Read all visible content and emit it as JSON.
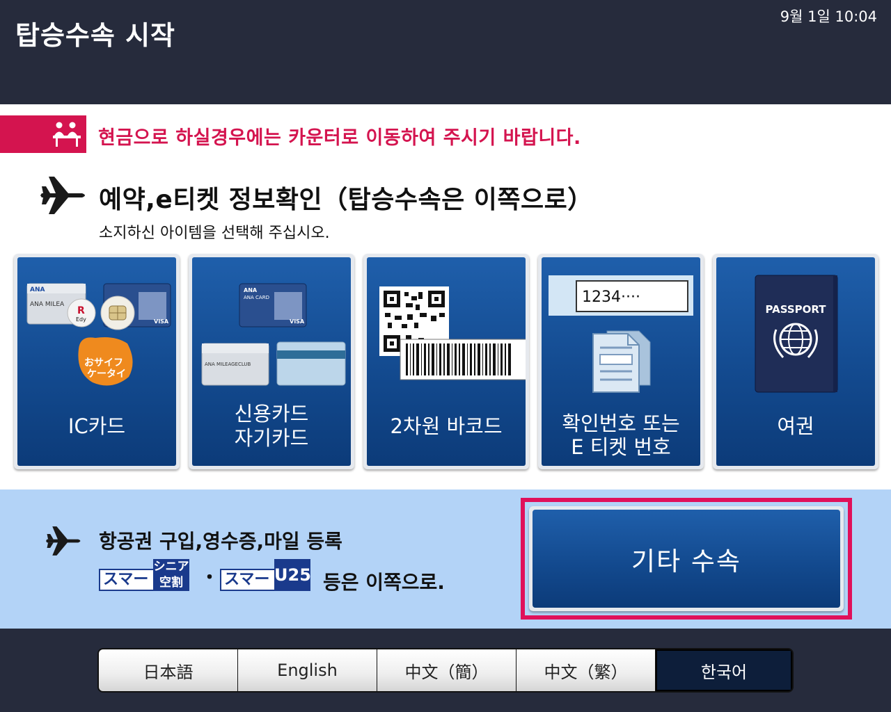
{
  "header": {
    "title": "탑승수속 시작",
    "datetime": "9월 1일  10:04"
  },
  "notice": {
    "text": "현금으로 하실경우에는 카운터로 이동하여 주시기 바랍니다.",
    "icon": "counter-staff-icon"
  },
  "section": {
    "title": "예약,e티켓 정보확인（탑승수속은 이쪽으로）",
    "subtitle": "소지하신 아이템을 선택해 주십시오.",
    "icon": "airplane-icon"
  },
  "options": [
    {
      "label": "IC카드",
      "icon": "ic-card-icon"
    },
    {
      "label_line1": "신용카드",
      "label_line2": "자기카드",
      "icon": "credit-card-icon"
    },
    {
      "label": "2차원 바코드",
      "icon": "barcode-icon"
    },
    {
      "label_line1": "확인번호 또는",
      "label_line2": "E 티켓 번호",
      "icon": "document-icon",
      "sample_number": "1234····"
    },
    {
      "label": "여권",
      "icon": "passport-icon",
      "passport_text": "PASSPORT"
    }
  ],
  "ic_card_art": {
    "card_brand": "ANA",
    "card_text": "ANA MILEA",
    "card_visa": "VISA",
    "edy_r": "R",
    "edy_text": "Edy",
    "osaifu_line1": "おサイフ",
    "osaifu_line2": "ケータイ"
  },
  "credit_card_art": {
    "card_brand": "ANA",
    "card_text": "ANA CARD",
    "card_visa": "VISA",
    "club_text": "ANA MILEAGECLUB"
  },
  "other": {
    "title": "항공권 구입,영수증,마일 등록",
    "logo1_word": "スマート",
    "logo1_mark_line1": "シニア",
    "logo1_mark_line2": "空割",
    "separator": "・",
    "logo2_word": "スマート",
    "logo2_mark": "U25",
    "tail": "등은 이쪽으로.",
    "button_label": "기타 수속"
  },
  "languages": [
    {
      "label": "日本語",
      "active": false
    },
    {
      "label": "English",
      "active": false
    },
    {
      "label": "中文（簡）",
      "active": false
    },
    {
      "label": "中文（繁）",
      "active": false
    },
    {
      "label": "한국어",
      "active": true
    }
  ],
  "colors": {
    "header_bg": "#262b3c",
    "notice_red": "#d4144f",
    "tile_blue": "#134a8f",
    "band_blue": "#b3d3f7",
    "highlight": "#e0105a"
  }
}
